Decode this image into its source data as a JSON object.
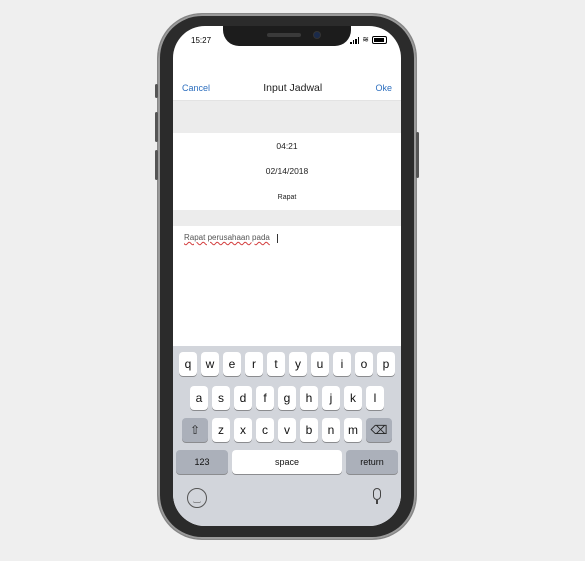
{
  "status": {
    "time": "15:27"
  },
  "nav": {
    "cancel": "Cancel",
    "title": "Input Jadwal",
    "ok": "Oke"
  },
  "form": {
    "time": "04:21",
    "date": "02/14/2018",
    "category": "Rapat",
    "description": "Rapat perusahaan pada"
  },
  "keyboard": {
    "row1": [
      "q",
      "w",
      "e",
      "r",
      "t",
      "y",
      "u",
      "i",
      "o",
      "p"
    ],
    "row2": [
      "a",
      "s",
      "d",
      "f",
      "g",
      "h",
      "j",
      "k",
      "l"
    ],
    "row3": [
      "z",
      "x",
      "c",
      "v",
      "b",
      "n",
      "m"
    ],
    "num_label": "123",
    "space_label": "space",
    "return_label": "return"
  },
  "icons": {
    "shift": "shift-icon",
    "backspace": "backspace-icon",
    "emoji": "emoji-icon",
    "mic": "microphone-icon"
  }
}
